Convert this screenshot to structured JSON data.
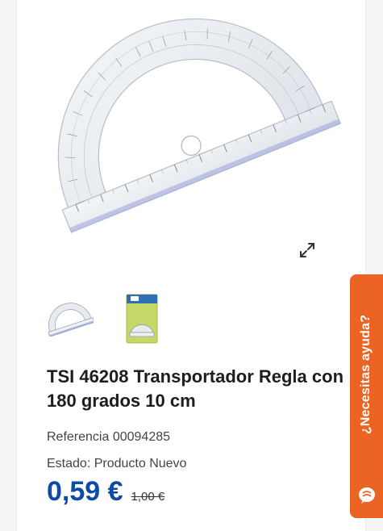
{
  "product": {
    "title": "TSI 46208 Transportador Regla con 180 grados 10 cm",
    "reference": "Referencia 00094285",
    "state": "Estado: Producto Nuevo",
    "price": "0,59 €",
    "old_price": "1,00 €"
  },
  "gallery": {
    "expand_icon": "expand-arrows-icon",
    "thumbnails": [
      {
        "icon": "protractor-thumbnail"
      },
      {
        "icon": "protractor-packaging-thumbnail"
      }
    ]
  },
  "help": {
    "label": "¿Necesitas ayuda?",
    "icon": "chat-bubble-icon"
  },
  "colors": {
    "price": "#0e4aa6",
    "help_tab": "#ec6424",
    "title": "#1d1d1d"
  }
}
